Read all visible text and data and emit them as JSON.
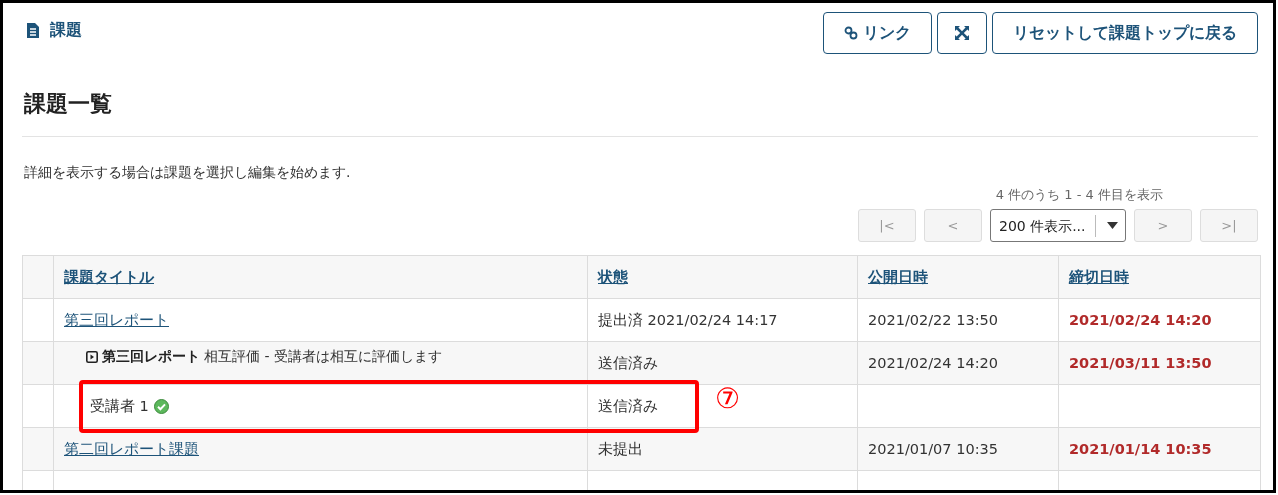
{
  "header": {
    "title": "課題",
    "buttons": [
      {
        "kind": "link",
        "label": "リンク"
      },
      {
        "kind": "expand"
      },
      {
        "kind": "text",
        "label": "リセットして課題トップに戻る"
      }
    ]
  },
  "heading": "課題一覧",
  "description": "詳細を表示する場合は課題を選択し編集を始めます.",
  "pager": {
    "summary": "4 件のうち 1 - 4 件目を表示",
    "page_size": "200 件表示...",
    "buttons": [
      {
        "label": "|<",
        "disabled": true
      },
      {
        "label": "<",
        "disabled": true
      },
      {
        "label": ">",
        "disabled": true
      },
      {
        "label": ">|",
        "disabled": true
      }
    ]
  },
  "table": {
    "columns": [
      "課題タイトル",
      "状態",
      "公開日時",
      "締切日時"
    ],
    "rows": [
      {
        "kind": "assignment",
        "title": "第三回レポート",
        "status": "提出済 2021/02/24 14:17",
        "open": "2021/02/22 13:50",
        "due": "2021/02/24 14:20"
      },
      {
        "kind": "peer",
        "title": "第三回レポート",
        "note": "相互評価 - 受講者は相互に評価します",
        "status": "送信済み",
        "open": "2021/02/24 14:20",
        "due": "2021/03/11 13:50"
      },
      {
        "kind": "student",
        "title": "受講者 1",
        "done": true,
        "status": "送信済み",
        "annotation": "⑦"
      },
      {
        "kind": "assignment",
        "title": "第二回レポート課題",
        "status": "未提出",
        "open": "2021/01/07 10:35",
        "due": "2021/01/14 10:35"
      },
      {
        "kind": "blank"
      }
    ]
  }
}
